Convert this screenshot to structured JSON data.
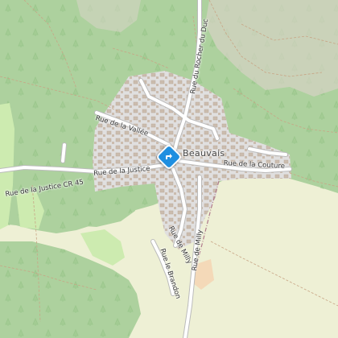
{
  "map": {
    "place_label": "Beauvais",
    "marker_icon": "directions-sign-icon",
    "colors": {
      "background": "#f2efe9",
      "forest": "#add19e",
      "farmland": "#eef0d5",
      "meadow": "#cdebb0",
      "residential": "#e0dfdf",
      "road": "#ffffff",
      "marker": "#1f8fe0"
    },
    "streets": [
      {
        "key": "rue_de_la_vallee",
        "label": "Rue de la Vallée"
      },
      {
        "key": "rue_du_rocher_du_duc",
        "label": "Rue du Rocher du Duc"
      },
      {
        "key": "rue_de_la_justice_cr45",
        "label": "Rue de la Justice  CR 45"
      },
      {
        "key": "rue_de_la_justice",
        "label": "Rue de la Justice"
      },
      {
        "key": "rue_de_la_couture",
        "label": "Rue de la Couture"
      },
      {
        "key": "rue_de_milly_upper",
        "label": "Rue de Milly"
      },
      {
        "key": "rue_le_brandon",
        "label": "Rue le Brandon"
      },
      {
        "key": "rue_de_milly_lower",
        "label": "Rue de Milly"
      }
    ]
  }
}
